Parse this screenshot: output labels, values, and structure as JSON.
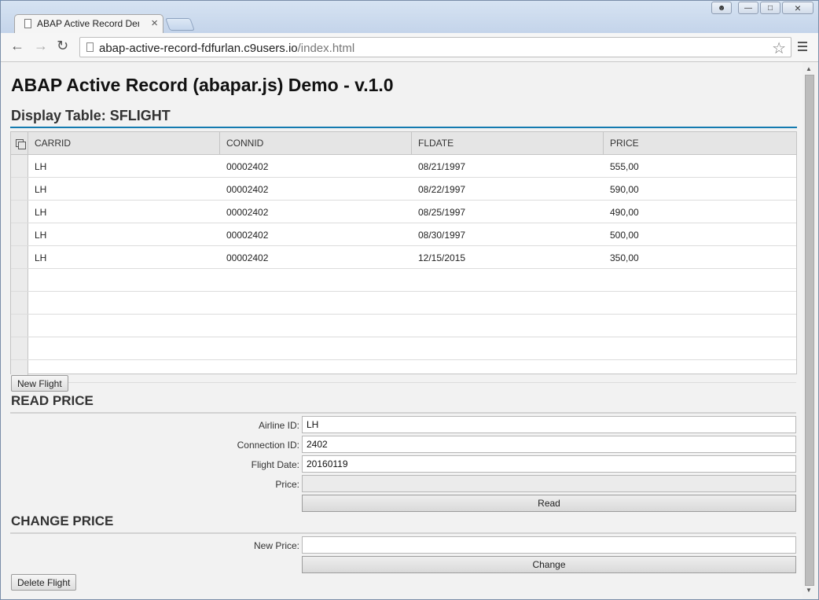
{
  "browser": {
    "tab_title": "ABAP Active Record Demo",
    "url_host": "abap-active-record-fdfurlan.c9users.io",
    "url_path": "/index.html"
  },
  "page": {
    "title": "ABAP Active Record (abapar.js) Demo - v.1.0",
    "table_title": "Display Table: SFLIGHT",
    "columns": [
      "CARRID",
      "CONNID",
      "FLDATE",
      "PRICE"
    ],
    "rows": [
      [
        "LH",
        "00002402",
        "08/21/1997",
        "555,00"
      ],
      [
        "LH",
        "00002402",
        "08/22/1997",
        "590,00"
      ],
      [
        "LH",
        "00002402",
        "08/25/1997",
        "490,00"
      ],
      [
        "LH",
        "00002402",
        "08/30/1997",
        "500,00"
      ],
      [
        "LH",
        "00002402",
        "12/15/2015",
        "350,00"
      ]
    ],
    "new_flight_label": "New Flight",
    "read_price": {
      "title": "READ PRICE",
      "airline_label": "Airline ID:",
      "airline_value": "LH",
      "connection_label": "Connection ID:",
      "connection_value": "2402",
      "date_label": "Flight Date:",
      "date_value": "20160119",
      "price_label": "Price:",
      "price_value": "",
      "read_label": "Read"
    },
    "change_price": {
      "title": "CHANGE PRICE",
      "new_price_label": "New Price:",
      "new_price_value": "",
      "change_label": "Change"
    },
    "delete_flight_label": "Delete Flight"
  }
}
